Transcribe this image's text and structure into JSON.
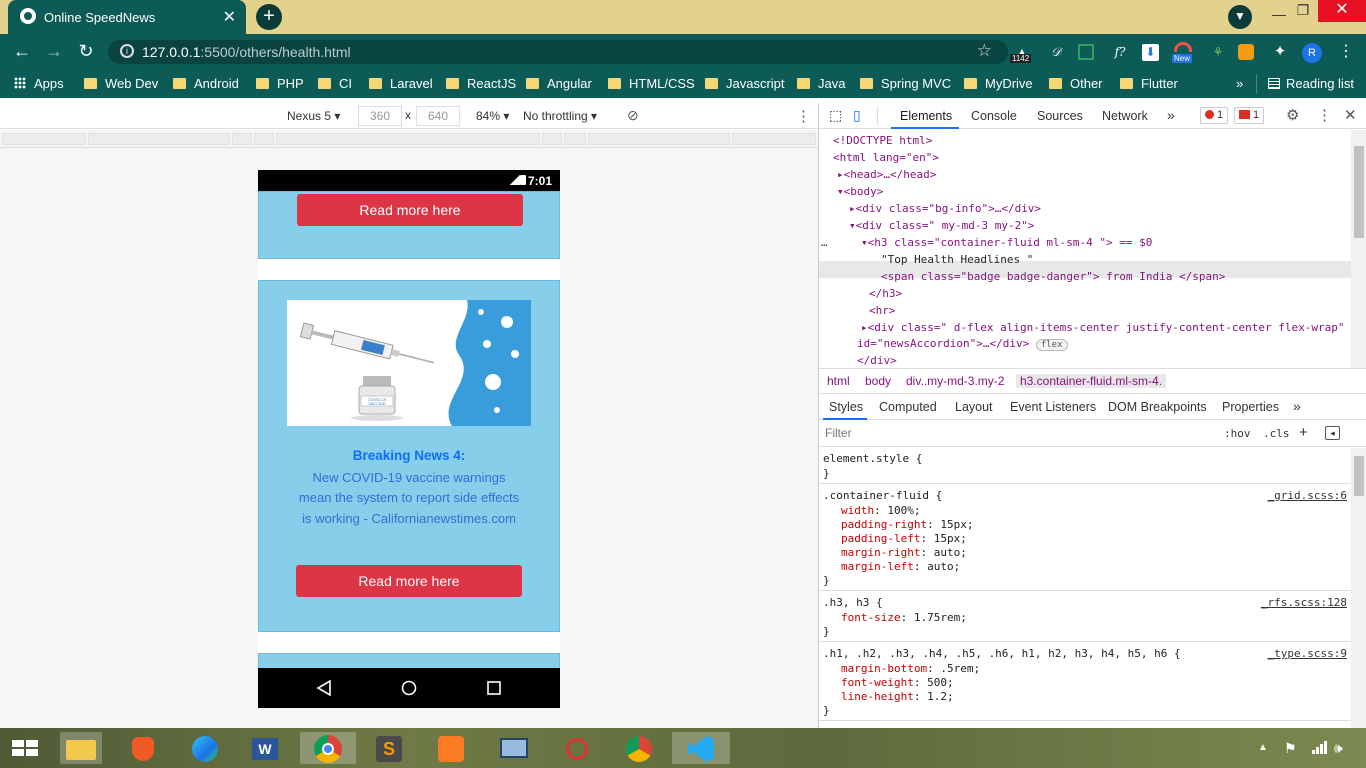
{
  "browser": {
    "tab_title": "Online SpeedNews",
    "new_tab": "+",
    "url_host": "127.0.0.1",
    "url_rest": ":5500/others/health.html",
    "ext_badge": "1142",
    "ext_new": "New",
    "avatar": "R"
  },
  "bookmarks": {
    "apps": "Apps",
    "items": [
      "Web Dev",
      "Android",
      "PHP",
      "CI",
      "Laravel",
      "ReactJS",
      "Angular",
      "HTML/CSS",
      "Javascript",
      "Java",
      "Spring MVC",
      "MyDrive",
      "Other",
      "Flutter"
    ],
    "overflow": "»",
    "reading_list": "Reading list"
  },
  "device_toolbar": {
    "device": "Nexus 5",
    "width": "360",
    "times": "x",
    "height": "640",
    "zoom": "84%",
    "throttling": "No throttling"
  },
  "phone": {
    "time": "7:01",
    "read_more_1": "Read more here",
    "news_title": "Breaking News 4:",
    "news_body": "New COVID-19 vaccine warnings mean the system to report side effects is working - Californianewstimes.com",
    "read_more_2": "Read more here",
    "vial_label": "COVID-19 VACCINE"
  },
  "devtools": {
    "tabs": [
      "Elements",
      "Console",
      "Sources",
      "Network"
    ],
    "more": "»",
    "errors": "1",
    "issues": "1",
    "dom_lines": [
      "<!DOCTYPE html>",
      "<html lang=\"en\">",
      "<head>…</head>",
      "<body>",
      "<div class=\"bg-info\">…</div>",
      "<div class=\" my-md-3 my-2\">",
      "<h3 class=\"container-fluid ml-sm-4 \"> == $0",
      "\"Top Health Headlines \"",
      "<span class=\"badge badge-danger\"> from India </span>",
      "</h3>",
      "<hr>",
      "<div class=\" d-flex align-items-center justify-content-center flex-wrap\"",
      "id=\"newsAccordion\">…</div>",
      "</div>"
    ],
    "flex_badge": "flex",
    "ellipsis": "…",
    "breadcrumbs": [
      "html",
      "body",
      "div..my-md-3.my-2",
      "h3.container-fluid.ml-sm-4."
    ],
    "style_tabs": [
      "Styles",
      "Computed",
      "Layout",
      "Event Listeners",
      "DOM Breakpoints",
      "Properties"
    ],
    "filter_placeholder": "Filter",
    "hov": ":hov",
    "cls": ".cls",
    "rules": [
      {
        "selector": "element.style {",
        "source": "",
        "props": []
      },
      {
        "selector": ".container-fluid {",
        "source": "_grid.scss:6",
        "props": [
          [
            "width",
            "100%;"
          ],
          [
            "padding-right",
            "15px;"
          ],
          [
            "padding-left",
            "15px;"
          ],
          [
            "margin-right",
            "auto;"
          ],
          [
            "margin-left",
            "auto;"
          ]
        ]
      },
      {
        "selector": ".h3, h3 {",
        "source": "_rfs.scss:128",
        "props": [
          [
            "font-size",
            "1.75rem;"
          ]
        ]
      },
      {
        "selector": ".h1, .h2, .h3, .h4, .h5, .h6, h1, h2, h3, h4, h5, h6 {",
        "source": "_type.scss:9",
        "props": [
          [
            "margin-bottom",
            ".5rem;"
          ],
          [
            "font-weight",
            "500;"
          ],
          [
            "line-height",
            "1.2;"
          ]
        ]
      }
    ],
    "close_brace": "}"
  }
}
